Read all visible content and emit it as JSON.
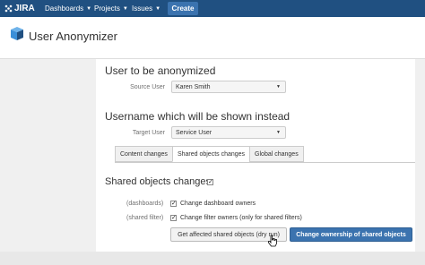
{
  "topbar": {
    "logo_text": "JIRA",
    "nav": [
      {
        "label": "Dashboards"
      },
      {
        "label": "Projects"
      },
      {
        "label": "Issues"
      }
    ],
    "create_label": "Create"
  },
  "header": {
    "title": "User Anonymizer"
  },
  "anonymize": {
    "heading": "User to be anonymized",
    "source_user_label": "Source User",
    "source_user_value": "Karen Smith"
  },
  "target": {
    "heading": "Username which will be shown instead",
    "target_user_label": "Target User",
    "target_user_value": "Service User"
  },
  "tabs": [
    {
      "label": "Content changes"
    },
    {
      "label": "Shared objects changes"
    },
    {
      "label": "Global changes"
    }
  ],
  "shared": {
    "heading": "Shared objects changes",
    "heading_checked": true,
    "rows": [
      {
        "category": "(dashboards)",
        "text": "Change dashboard owners",
        "checked": true
      },
      {
        "category": "(shared filter)",
        "text": "Change filter owners (only for shared filters)",
        "checked": true
      }
    ],
    "dry_run_label": "Get affected shared objects (dry run)",
    "submit_label": "Change ownership of shared objects"
  },
  "colors": {
    "topbar": "#205081",
    "primary_button": "#3b73af"
  }
}
